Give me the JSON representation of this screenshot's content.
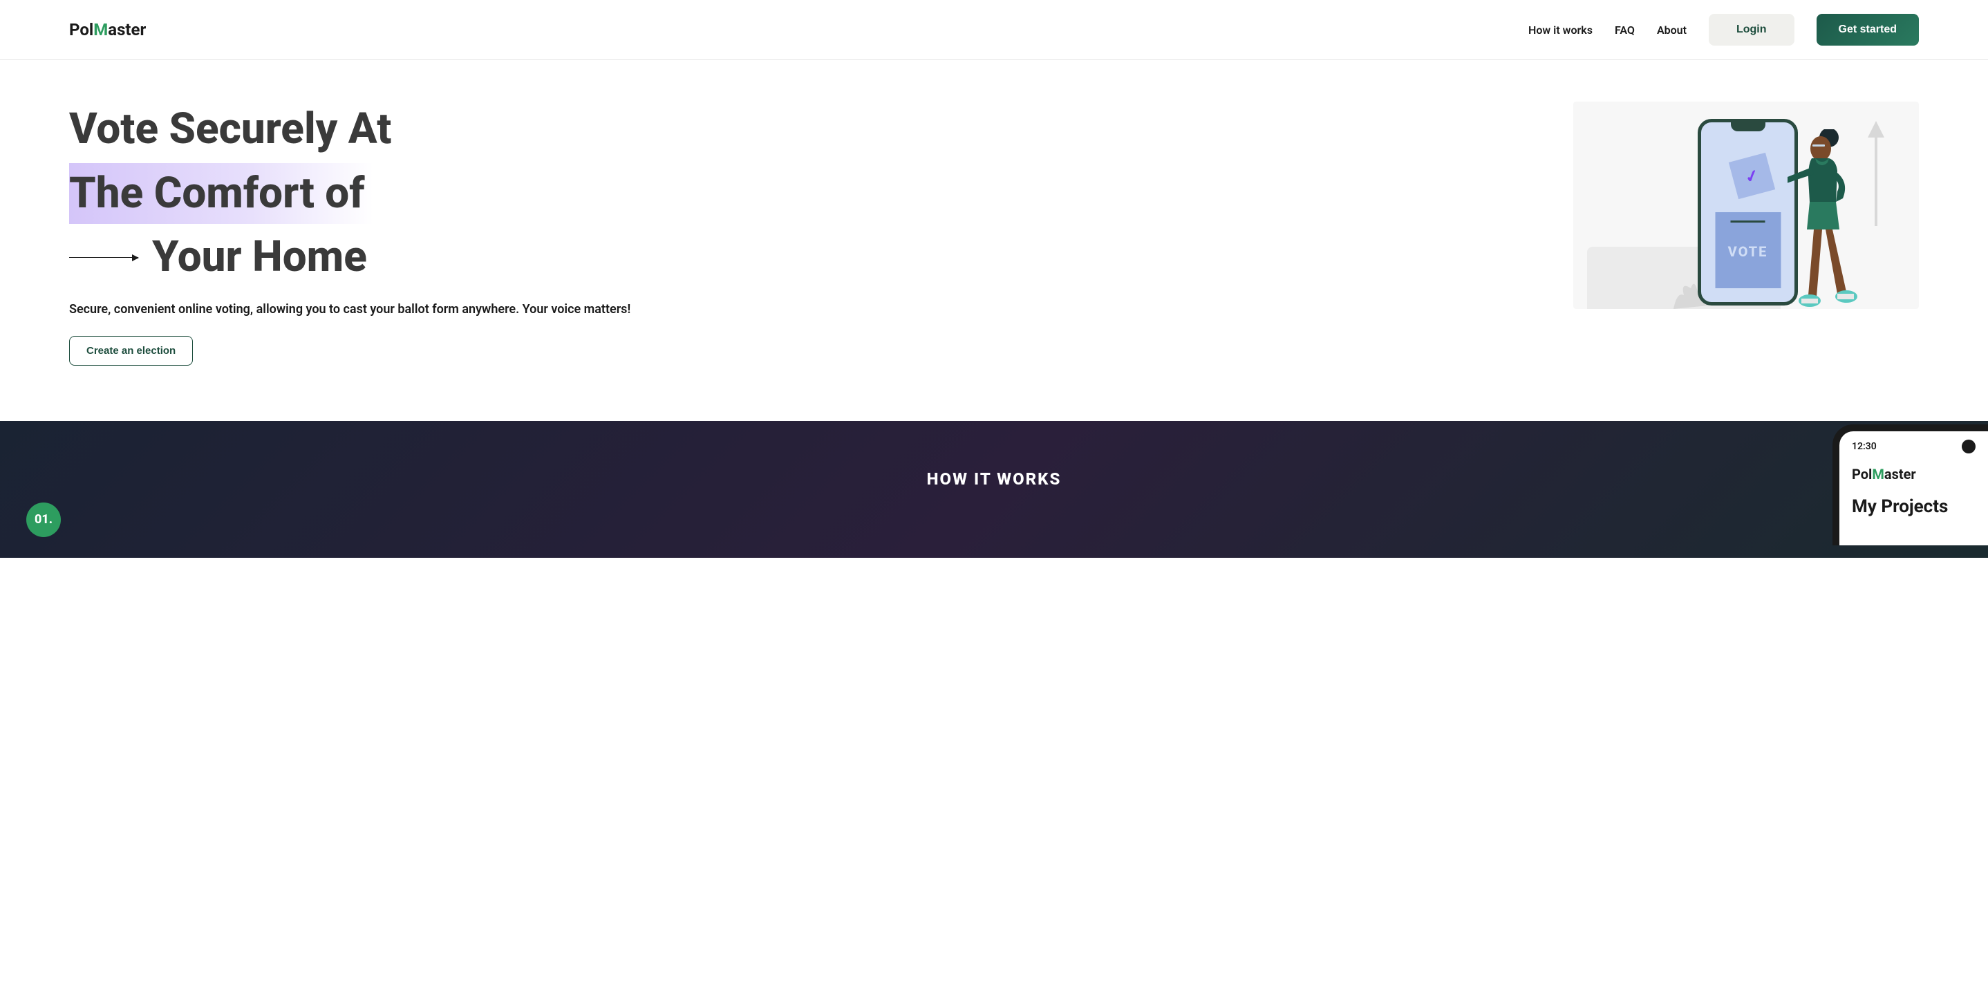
{
  "header": {
    "logo_prefix": "Pol",
    "logo_m": "M",
    "logo_suffix": "aster",
    "nav": {
      "how_it_works": "How it works",
      "faq": "FAQ",
      "about": "About",
      "login": "Login",
      "get_started": "Get started"
    }
  },
  "hero": {
    "title_line1": "Vote Securely At",
    "title_line2": "The Comfort of",
    "title_line3": "Your Home",
    "subtitle": "Secure, convenient online voting, allowing you to cast your ballot form anywhere. Your voice matters!",
    "cta": "Create an election",
    "illustration": {
      "ballot_box_label": "VOTE",
      "checkmark_icon": "✓"
    }
  },
  "how_it_works": {
    "title": "HOW IT WORKS",
    "step_01": "01.",
    "phone_mockup": {
      "time": "12:30",
      "logo_prefix": "Pol",
      "logo_m": "M",
      "logo_suffix": "aster",
      "projects_title": "My Projects"
    }
  }
}
